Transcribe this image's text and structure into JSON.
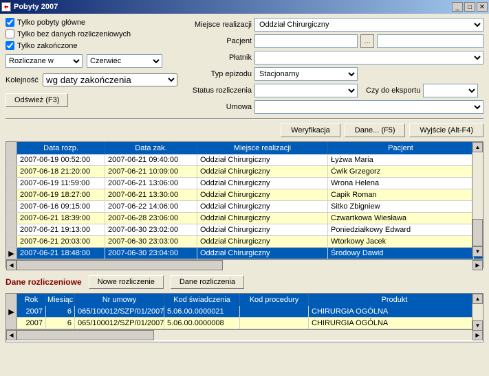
{
  "window": {
    "title": "Pobyty 2007"
  },
  "checkboxes": {
    "tylko_glowne": {
      "label": "Tylko pobyty główne",
      "checked": true
    },
    "tylko_bez_rozlicz": {
      "label": "Tylko bez danych rozliczeniowych",
      "checked": false
    },
    "tylko_zakonczone": {
      "label": "Tylko zakończone",
      "checked": true
    }
  },
  "filters": {
    "rozliczane_w": "Rozliczane w",
    "miesiac": "Czerwiec",
    "kolejnosc_label": "Kolejność",
    "kolejnosc_value": "wg daty zakończenia",
    "odswiez": "Odśwież (F3)"
  },
  "labels": {
    "miejsce": "Miejsce realizacji",
    "pacjent": "Pacjent",
    "platnik": "Płatnik",
    "typ_epizodu": "Typ epizodu",
    "status": "Status rozliczenia",
    "umowa": "Umowa",
    "czy_eksport": "Czy do eksportu"
  },
  "values": {
    "miejsce": "Oddział Chirurgiczny",
    "pacjent": "",
    "platnik": "",
    "typ_epizodu": "Stacjonarny",
    "status": "",
    "umowa": "",
    "czy_eksport": ""
  },
  "buttons": {
    "weryfikacja": "Weryfikacja",
    "dane": "Dane... (F5)",
    "wyjscie": "Wyjście (Alt-F4)",
    "nowe_rozl": "Nowe rozliczenie",
    "dane_rozl": "Dane rozliczenia"
  },
  "main_grid": {
    "headers": {
      "data_rozp": "Data rozp.",
      "data_zak": "Data zak.",
      "miejsce": "Miejsce realizacji",
      "pacjent": "Pacjent"
    },
    "rows": [
      {
        "dr": "2007-06-19 00:52:00",
        "dz": "2007-06-21 09:40:00",
        "mr": "Oddział Chirurgiczny",
        "pac": "Łyżwa Maria"
      },
      {
        "dr": "2007-06-18 21:20:00",
        "dz": "2007-06-21 10:09:00",
        "mr": "Oddział Chirurgiczny",
        "pac": "Ćwik Grzegorz"
      },
      {
        "dr": "2007-06-19 11:59:00",
        "dz": "2007-06-21 13:06:00",
        "mr": "Oddział Chirurgiczny",
        "pac": "Wrona Helena"
      },
      {
        "dr": "2007-06-19 18:27:00",
        "dz": "2007-06-21 13:30:00",
        "mr": "Oddział Chirurgiczny",
        "pac": "Capik Roman"
      },
      {
        "dr": "2007-06-16 09:15:00",
        "dz": "2007-06-22 14:06:00",
        "mr": "Oddział Chirurgiczny",
        "pac": "Sitko Zbigniew"
      },
      {
        "dr": "2007-06-21 18:39:00",
        "dz": "2007-06-28 23:06:00",
        "mr": "Oddział Chirurgiczny",
        "pac": "Czwartkowa Wiesława"
      },
      {
        "dr": "2007-06-21 19:13:00",
        "dz": "2007-06-30 23:02:00",
        "mr": "Oddział Chirurgiczny",
        "pac": "Poniedziałkowy Edward"
      },
      {
        "dr": "2007-06-21 20:03:00",
        "dz": "2007-06-30 23:03:00",
        "mr": "Oddział Chirurgiczny",
        "pac": "Wtorkowy Jacek"
      },
      {
        "dr": "2007-06-21 18:48:00",
        "dz": "2007-06-30 23:04:00",
        "mr": "Oddział Chirurgiczny",
        "pac": "Środowy Dawid",
        "selected": true
      }
    ]
  },
  "section": {
    "title": "Dane rozliczeniowe"
  },
  "sub_grid": {
    "headers": {
      "rok": "Rok",
      "mies": "Miesiąc",
      "nr": "Nr umowy",
      "kod1": "Kod świadczenia",
      "kod2": "Kod procedury",
      "prod": "Produkt"
    },
    "rows": [
      {
        "rok": "2007",
        "mies": "6",
        "nr": "065/100012/SZP/01/2007",
        "kod1": "5.06.00.0000021",
        "kod2": "",
        "prod": "CHIRURGIA OGÓLNA",
        "selected": true
      },
      {
        "rok": "2007",
        "mies": "6",
        "nr": "065/100012/SZP/01/2007",
        "kod1": "5.06.00.0000008",
        "kod2": "",
        "prod": "CHIRURGIA OGÓLNA"
      }
    ]
  }
}
